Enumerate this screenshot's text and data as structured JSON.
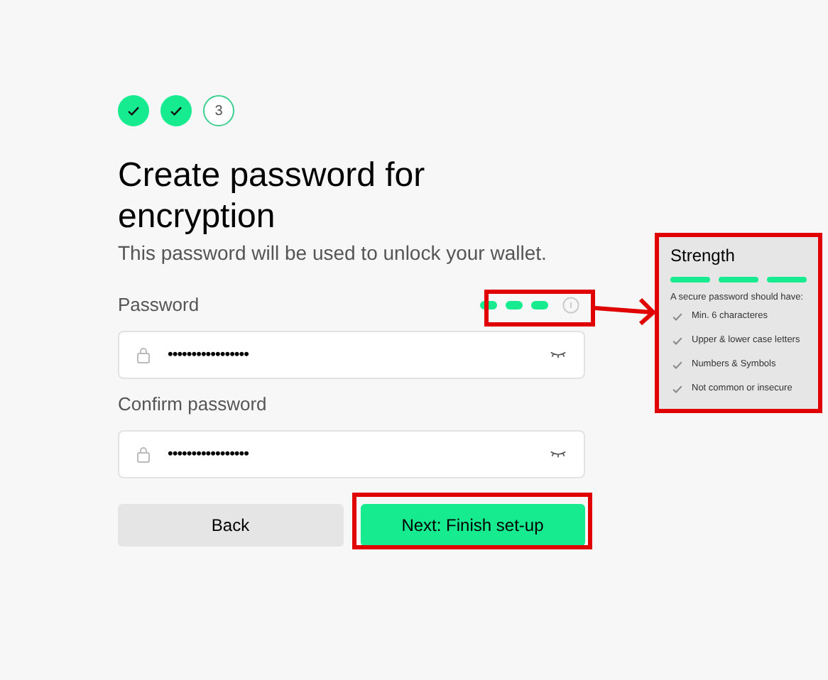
{
  "steps": [
    {
      "done": true
    },
    {
      "done": true
    },
    {
      "label": "3",
      "done": false
    }
  ],
  "title": "Create password for encryption",
  "subtitle": "This password will be used to unlock your wallet.",
  "fields": [
    {
      "label": "Password",
      "value": "•••••••••••••••••",
      "meter": [
        {
          "filled": true
        },
        {
          "filled": true
        },
        {
          "filled": true
        }
      ]
    },
    {
      "label": "Confirm password",
      "value": "•••••••••••••••••"
    }
  ],
  "buttons": [
    {
      "label": "Back",
      "kind": "secondary"
    },
    {
      "label": "Next: Finish set-up",
      "kind": "primary"
    }
  ],
  "strength_panel": {
    "title": "Strength",
    "bars": [
      {
        "filled": true
      },
      {
        "filled": true
      },
      {
        "filled": true
      }
    ],
    "intro": "A secure password should have:",
    "rules": [
      {
        "text": "Min. 6 characteres",
        "met": true
      },
      {
        "text": "Upper & lower case letters",
        "met": true
      },
      {
        "text": "Numbers & Symbols",
        "met": true
      },
      {
        "text": "Not common or insecure",
        "met": true
      }
    ]
  }
}
